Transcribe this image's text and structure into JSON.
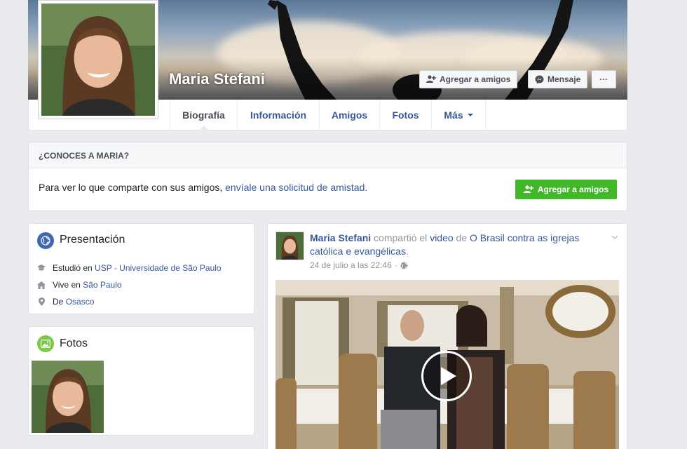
{
  "profile": {
    "name": "Maria Stefani",
    "add_friend_label": "Agregar a amigos",
    "message_label": "Mensaje",
    "more_label": "···"
  },
  "nav": {
    "tabs": [
      {
        "label": "Biografía",
        "active": true
      },
      {
        "label": "Información"
      },
      {
        "label": "Amigos"
      },
      {
        "label": "Fotos"
      },
      {
        "label": "Más"
      }
    ]
  },
  "know": {
    "heading": "¿CONOCES A MARIA?",
    "text_prefix": "Para ver lo que comparte con sus amigos, ",
    "text_link": "envíale una solicitud de amistad.",
    "button_label": "Agregar a amigos"
  },
  "intro": {
    "title": "Presentación",
    "study_prefix": "Estudió en ",
    "study_link": "USP - Universidade de São Paulo",
    "lives_prefix": "Vive en ",
    "lives_link": "São Paulo",
    "from_prefix": "De ",
    "from_link": "Osasco"
  },
  "photos": {
    "title": "Fotos"
  },
  "post": {
    "author": "Maria Stefani",
    "action": " compartió el ",
    "video_word": "video",
    "of": " de ",
    "page_name": "O Brasil contra as igrejas católica e evangélicas",
    "period": ".",
    "timestamp": "24 de julio a las 22:46",
    "separator": "·"
  },
  "colors": {
    "link": "#365899",
    "green_button": "#42b72a",
    "background": "#e9ebee"
  },
  "icons": {
    "intro": "globe-icon",
    "photos": "photo-icon",
    "study": "graduation-cap-icon",
    "lives": "home-icon",
    "from": "location-pin-icon",
    "audience": "globe-icon"
  }
}
